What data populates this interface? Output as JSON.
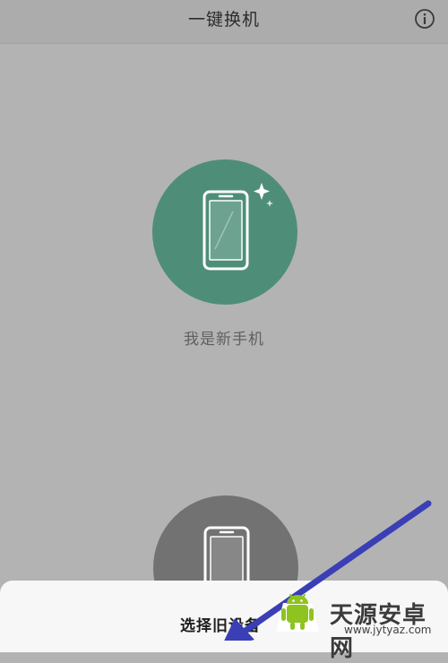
{
  "header": {
    "title": "一键换机",
    "info_icon": "info-circle-icon"
  },
  "new_phone": {
    "label": "我是新手机",
    "icon": "smartphone-sparkle-icon",
    "color": "#4e8e78"
  },
  "old_phone": {
    "icon": "smartphone-icon",
    "color": "#727272"
  },
  "sheet": {
    "title": "选择旧设备"
  },
  "annotation": {
    "icon": "arrow-annotation-icon",
    "color": "#3a3fb5"
  },
  "watermark": {
    "text": "天源安卓网",
    "url": "www.jytyaz.com",
    "icon": "android-logo-icon"
  }
}
